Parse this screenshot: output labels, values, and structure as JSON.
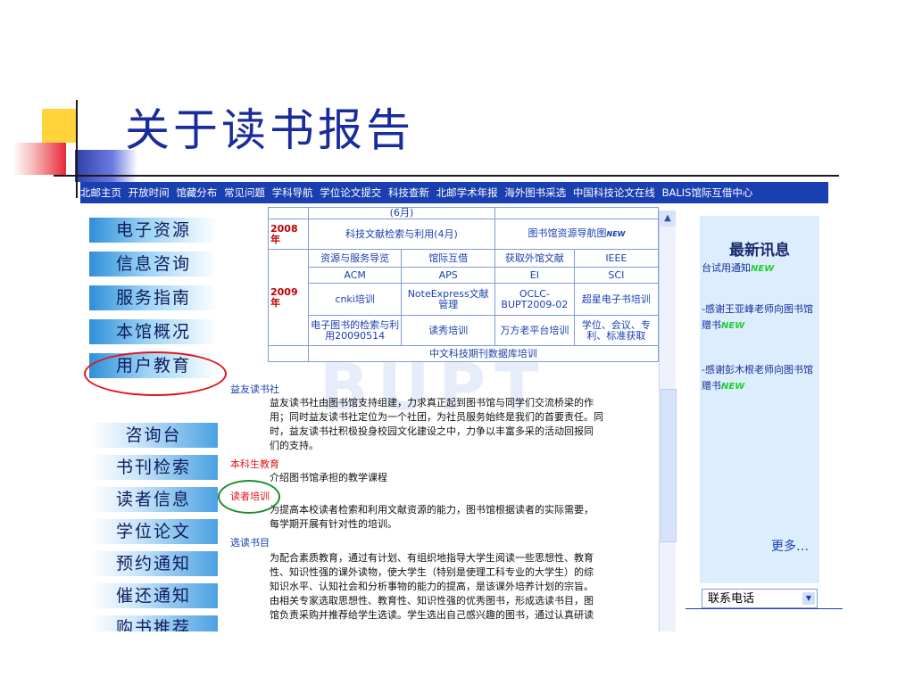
{
  "slide": {
    "title": "关于读书报告"
  },
  "navbar": [
    "北邮主页",
    "开放时间",
    "馆藏分布",
    "常见问题",
    "学科导航",
    "学位论文提交",
    "科技查新",
    "北邮学术年报",
    "海外图书采选",
    "中国科技论文在线",
    "BALIS馆际互借中心"
  ],
  "left_menu": [
    "电子资源",
    "信息咨询",
    "服务指南",
    "本馆概况",
    "用户教育"
  ],
  "left_menu2": [
    "咨询台",
    "书刊检索",
    "读者信息",
    "学位论文",
    "预约通知",
    "催还通知",
    "购书推荐"
  ],
  "table": {
    "top_partial": "(6月)",
    "row2008": {
      "year": "2008年",
      "c1": "科技文献检索与利用(4月)",
      "c2": "图书馆资源导航图"
    },
    "row2009_year": "2009年",
    "rows2009": [
      [
        "资源与服务导览",
        "馆际互借",
        "获取外馆文献",
        "IEEE"
      ],
      [
        "ACM",
        "APS",
        "EI",
        "SCI"
      ],
      [
        "cnki培训",
        "NoteExpress文献管理",
        "OCLC-BUPT2009-02",
        "超星电子书培训"
      ],
      [
        "电子图书的检索与利用20090514",
        "读秀培训",
        "万方老平台培训",
        "学位、会议、专利、标准获取"
      ]
    ],
    "last_row": "中文科技期刊数据库培训"
  },
  "sections": {
    "s1_title": "益友读书社",
    "s1_lines": [
      "益友读书社由图书馆支持组建，力求真正起到图书馆与同学们交流桥梁的作",
      "用；同时益友读书社定位为一个社团，为社员服务始终是我们的首要责任。同",
      "时，益友读书社积极投身校园文化建设之中，力争以丰富多采的活动回报同",
      "们的支持。"
    ],
    "s2_title": "本科生教育",
    "s2_lines": [
      "介绍图书馆承担的教学课程"
    ],
    "s3_title": "读者培训",
    "s3_lines": [
      "为提高本校读者检索和利用文献资源的能力，图书馆根据读者的实际需要，",
      "每学期开展有针对性的培训。"
    ],
    "s4_title": "选读书目",
    "s4_lines": [
      "为配合素质教育，通过有计划、有组织地指导大学生阅读一些思想性、教育",
      "性、知识性强的课外读物，使大学生（特别是使理工科专业的大学生）的综",
      "知识水平、认知社会和分析事物的能力的提高，是该课外培养计划的宗旨。",
      "由相关专家选取思想性、教育性、知识性强的优秀图书，形成选读书目，图",
      "馆负责采购并推荐给学生选读。学生选出自己感兴趣的图书，通过认真研读"
    ]
  },
  "right_panel": {
    "title": "最新讯息",
    "news": [
      {
        "text": "台试用通知",
        "badge": "NEW"
      },
      {
        "text": "-感谢王亚峰老师向图书馆赠书",
        "badge": "NEW"
      },
      {
        "text": "-感谢彭木根老师向图书馆赠书",
        "badge": "NEW"
      }
    ],
    "more": "更多…",
    "select_value": "联系电话"
  },
  "watermark": "BUPT",
  "colors": {
    "nav_bg": "#1a3fb0",
    "title": "#1a2c9b",
    "section_red": "#e0141e",
    "section_blue": "#1a3fb0"
  }
}
